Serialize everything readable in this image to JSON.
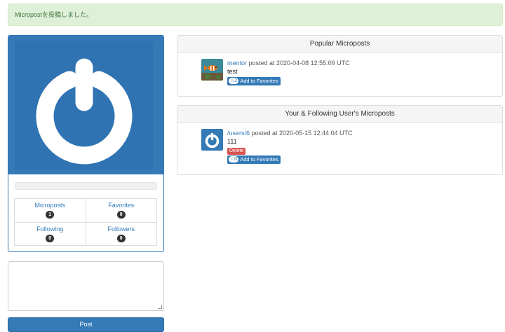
{
  "flash": {
    "message": "Micropostを投稿しました。"
  },
  "profile": {
    "stats": [
      {
        "label": "Microposts",
        "count": "1"
      },
      {
        "label": "Favorites",
        "count": "0"
      },
      {
        "label": "Following",
        "count": "0"
      },
      {
        "label": "Followers",
        "count": "0"
      }
    ]
  },
  "form": {
    "post_label": "Post",
    "textarea_value": ""
  },
  "popular": {
    "title": "Popular Microposts",
    "items": [
      {
        "user": "mentor",
        "meta": " posted at 2020-04-08 12:55:09 UTC",
        "content": "test",
        "fav_count": "2",
        "fav_label": "Add to Favorites"
      }
    ]
  },
  "feed": {
    "title": "Your & Following User's Microposts",
    "items": [
      {
        "user": "/users/6",
        "meta": " posted at 2020-05-15 12:44:04 UTC",
        "content": "111",
        "delete_label": "Delete",
        "fav_count": "0",
        "fav_label": "Add to Favorites"
      }
    ]
  },
  "colors": {
    "primary": "#337ab7",
    "success_bg": "#dff0d8",
    "success_text": "#3c763d",
    "danger": "#d9534f"
  },
  "icons": {
    "star": "star-icon",
    "avatar": "power-avatar-icon"
  }
}
